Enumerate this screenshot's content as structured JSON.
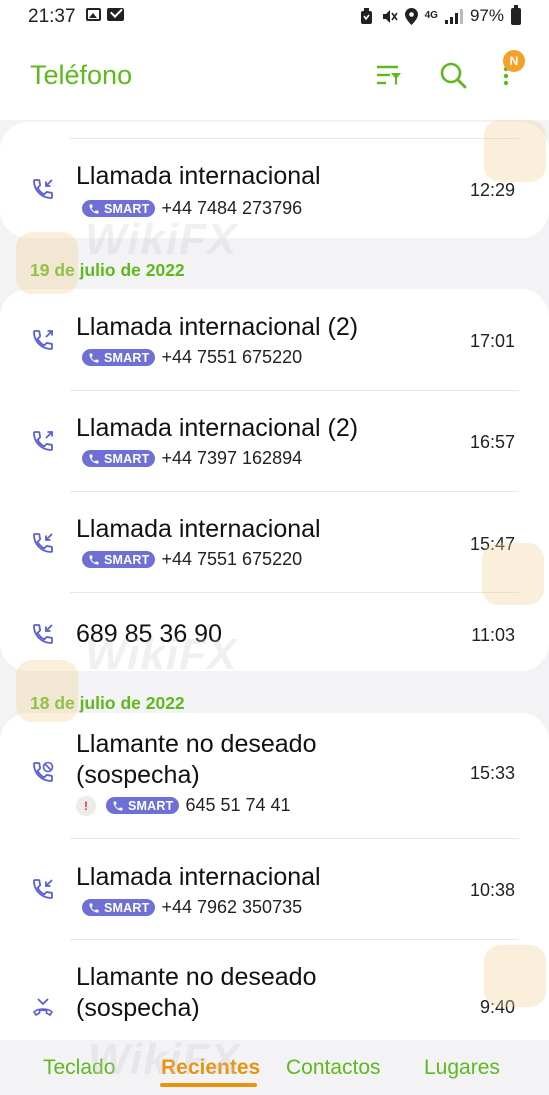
{
  "status_bar": {
    "time": "21:37",
    "battery": "97%",
    "network": "4G"
  },
  "header": {
    "title": "Teléfono",
    "notification_badge": "N"
  },
  "groups": [
    {
      "date": "",
      "calls": [
        {
          "type": "incoming",
          "name": "Llamada internacional",
          "smart": "SMART",
          "number": "+44 7484 273796",
          "time": "12:29"
        }
      ]
    },
    {
      "date": "19 de julio de 2022",
      "calls": [
        {
          "type": "outgoing",
          "name": "Llamada internacional (2)",
          "smart": "SMART",
          "number": "+44 7551 675220",
          "time": "17:01"
        },
        {
          "type": "outgoing",
          "name": "Llamada internacional (2)",
          "smart": "SMART",
          "number": "+44 7397 162894",
          "time": "16:57"
        },
        {
          "type": "incoming",
          "name": "Llamada internacional",
          "smart": "SMART",
          "number": "+44 7551 675220",
          "time": "15:47"
        },
        {
          "type": "incoming",
          "name": "689 85 36 90",
          "smart": "",
          "number": "",
          "time": "11:03"
        }
      ]
    },
    {
      "date": "18 de julio de 2022",
      "calls": [
        {
          "type": "blocked",
          "name_line1": "Llamante no deseado",
          "name_line2": "(sospecha)",
          "warning": "!",
          "smart": "SMART",
          "number": "645 51 74 41",
          "time": "15:33"
        },
        {
          "type": "incoming",
          "name": "Llamada internacional",
          "smart": "SMART",
          "number": "+44 7962 350735",
          "time": "10:38"
        },
        {
          "type": "rejected",
          "name_line1": "Llamante no deseado",
          "name_line2": "(sospecha)",
          "time": "9:40"
        }
      ]
    }
  ],
  "bottom_nav": {
    "keypad": "Teclado",
    "recents": "Recientes",
    "contacts": "Contactos",
    "places": "Lugares"
  },
  "watermark": "WikiFX",
  "colors": {
    "accent_green": "#5fb91d",
    "accent_orange": "#e8940e",
    "smart_purple": "#6e70d6",
    "call_icon_purple": "#5a5fd1"
  }
}
